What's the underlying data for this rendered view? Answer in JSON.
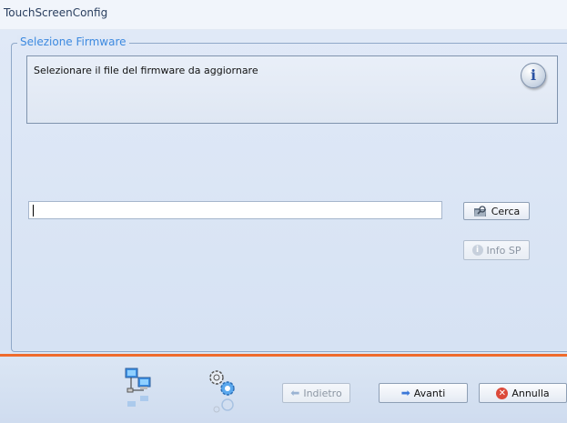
{
  "window": {
    "title": "TouchScreenConfig"
  },
  "group": {
    "title": "Selezione Firmware"
  },
  "info": {
    "message": "Selezionare il file del firmware da aggiornare",
    "icon": "info-icon"
  },
  "file_input": {
    "value": "",
    "placeholder": ""
  },
  "buttons": {
    "cerca": {
      "label": "Cerca",
      "icon": "search-folder-icon"
    },
    "info_sp": {
      "label": "Info SP",
      "icon": "info-icon",
      "disabled": true
    },
    "indietro": {
      "label": "Indietro",
      "icon": "arrow-left-icon",
      "disabled": true
    },
    "avanti": {
      "label": "Avanti",
      "icon": "arrow-right-icon"
    },
    "annulla": {
      "label": "Annulla",
      "icon": "close-icon"
    }
  },
  "footer_icons": [
    "network-computers-icon",
    "gear-settings-icon"
  ],
  "colors": {
    "accent": "#ef6b2c",
    "group_title": "#3d8ae0",
    "background": "#dbe6f4"
  }
}
